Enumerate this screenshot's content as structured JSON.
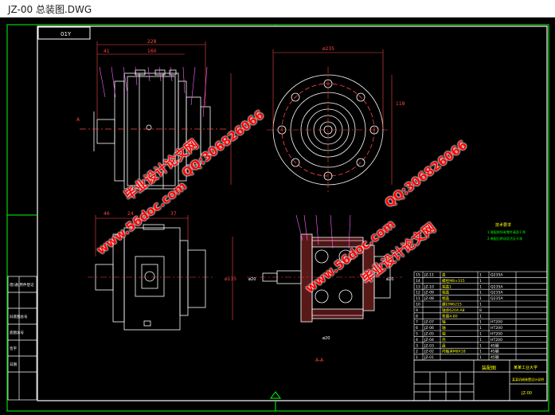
{
  "window": {
    "title": "JZ-00 总装图.DWG"
  },
  "drawing": {
    "corner_label": "01Y",
    "section_label": "A-A",
    "arrow_label": "A",
    "dims_top": [
      "41",
      "160",
      "228",
      "ø235",
      "118"
    ],
    "dims_bottom": [
      "46",
      "24",
      "57",
      "37",
      "ø135"
    ],
    "dims_section": [
      "ø20",
      "ø20",
      "ø20"
    ],
    "tech_title": "技术要求",
    "tech_lines": [
      "1.装配前所有零件清洗干净",
      "2.装配后转动灵活无卡滞"
    ],
    "left_labels": [
      "借(通)用件登记",
      "",
      "旧底图总号",
      "底图总号",
      "签字",
      "日期"
    ],
    "bom": [
      {
        "no": "15",
        "code": "JZ-11",
        "name": "盖",
        "qty": "1",
        "mat": "Q235A"
      },
      {
        "no": "14",
        "code": "",
        "name": "螺栓M8×315",
        "qty": "1",
        "mat": ""
      },
      {
        "no": "13",
        "code": "JZ-10",
        "name": "端盖1",
        "qty": "1",
        "mat": "Q235A"
      },
      {
        "no": "12",
        "code": "JZ-09",
        "name": "端盖",
        "qty": "1",
        "mat": "Q235A"
      },
      {
        "no": "11",
        "code": "JZ-08",
        "name": "端盖",
        "qty": "1",
        "mat": "Q235A"
      },
      {
        "no": "10",
        "code": "",
        "name": "螺钉M6215",
        "qty": "1",
        "mat": ""
      },
      {
        "no": "9",
        "code": "",
        "name": "轴承6204-A8",
        "qty": "8",
        "mat": ""
      },
      {
        "no": "8",
        "code": "",
        "name": "垫圈4-80",
        "qty": "1",
        "mat": ""
      },
      {
        "no": "7",
        "code": "JZ-07",
        "name": "轴",
        "qty": "1",
        "mat": "HT200"
      },
      {
        "no": "6",
        "code": "JZ-06",
        "name": "轴",
        "qty": "1",
        "mat": "HT200"
      },
      {
        "no": "5",
        "code": "JZ-05",
        "name": "端",
        "qty": "1",
        "mat": "HT200"
      },
      {
        "no": "4",
        "code": "JZ-04",
        "name": "壳",
        "qty": "1",
        "mat": "HT200"
      },
      {
        "no": "3",
        "code": "JZ-03",
        "name": "盘",
        "qty": "1",
        "mat": "45钢"
      },
      {
        "no": "2",
        "code": "JZ-02",
        "name": "内轴承M8X18",
        "qty": "1",
        "mat": "45钢"
      },
      {
        "no": "1",
        "code": "JZ-01",
        "name": "",
        "qty": "1",
        "mat": "45钢"
      }
    ],
    "titleblock": {
      "title": "装配图",
      "school": "某某工业大学",
      "subtitle": "某某机械装置设计说明",
      "code": "JZ-00"
    }
  },
  "watermarks": {
    "brand": "毕业设计论文网",
    "url": "www.56doc.com",
    "qq": "QQ:306826066"
  },
  "colors": {
    "background": "#000000",
    "border": "#ffffff",
    "geometry": "#ffffff",
    "dimension": "#ff4444",
    "center_line": "#ff4444",
    "frame_green": "#00ff00",
    "leader": "#ff66ff",
    "watermark": "#ff0000",
    "text_yellow": "#ffff00"
  }
}
